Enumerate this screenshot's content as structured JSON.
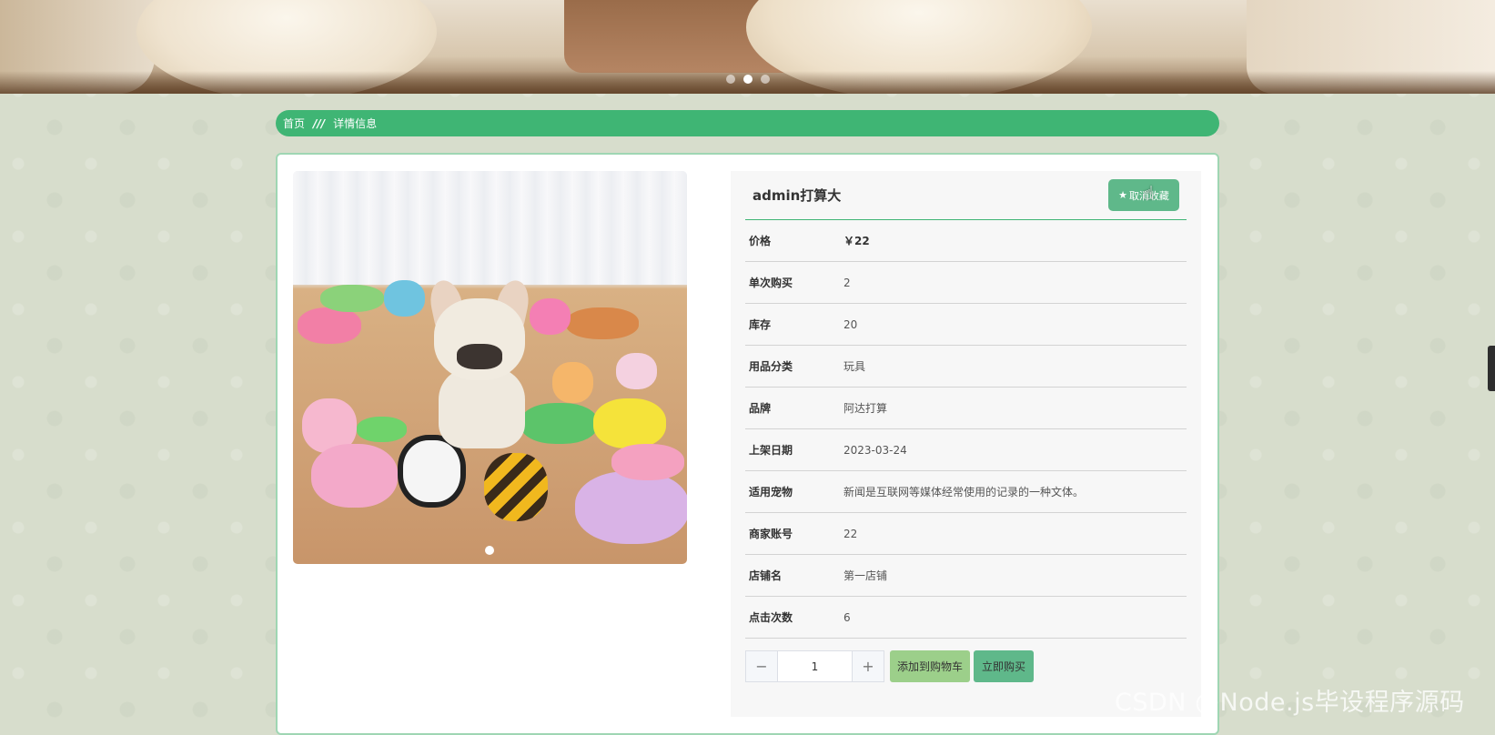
{
  "banner": {
    "slide_count": 3,
    "active_slide": 2
  },
  "breadcrumb": {
    "home": "首页",
    "separator": "///",
    "current": "详情信息"
  },
  "product": {
    "title": "admin打算大",
    "favorite_label": "取消收藏",
    "favorite_icon": "star-icon",
    "fields": [
      {
        "label": "价格",
        "value": "￥22"
      },
      {
        "label": "单次购买",
        "value": "2"
      },
      {
        "label": "库存",
        "value": "20"
      },
      {
        "label": "用品分类",
        "value": "玩具"
      },
      {
        "label": "品牌",
        "value": "阿达打算"
      },
      {
        "label": "上架日期",
        "value": "2023-03-24"
      },
      {
        "label": "适用宠物",
        "value": "新闻是互联网等媒体经常使用的记录的一种文体。"
      },
      {
        "label": "商家账号",
        "value": "22"
      },
      {
        "label": "店铺名",
        "value": "第一店铺"
      },
      {
        "label": "点击次数",
        "value": "6"
      }
    ],
    "quantity": "1",
    "minus_icon": "minus-icon",
    "plus_icon": "plus-icon",
    "add_to_cart_label": "添加到购物车",
    "buy_now_label": "立即购买"
  },
  "watermark": "CSDN @Node.js毕设程序源码",
  "colors": {
    "accent": "#3fb574",
    "button": "#5fb88a",
    "cart_button": "#9ccf8a"
  }
}
